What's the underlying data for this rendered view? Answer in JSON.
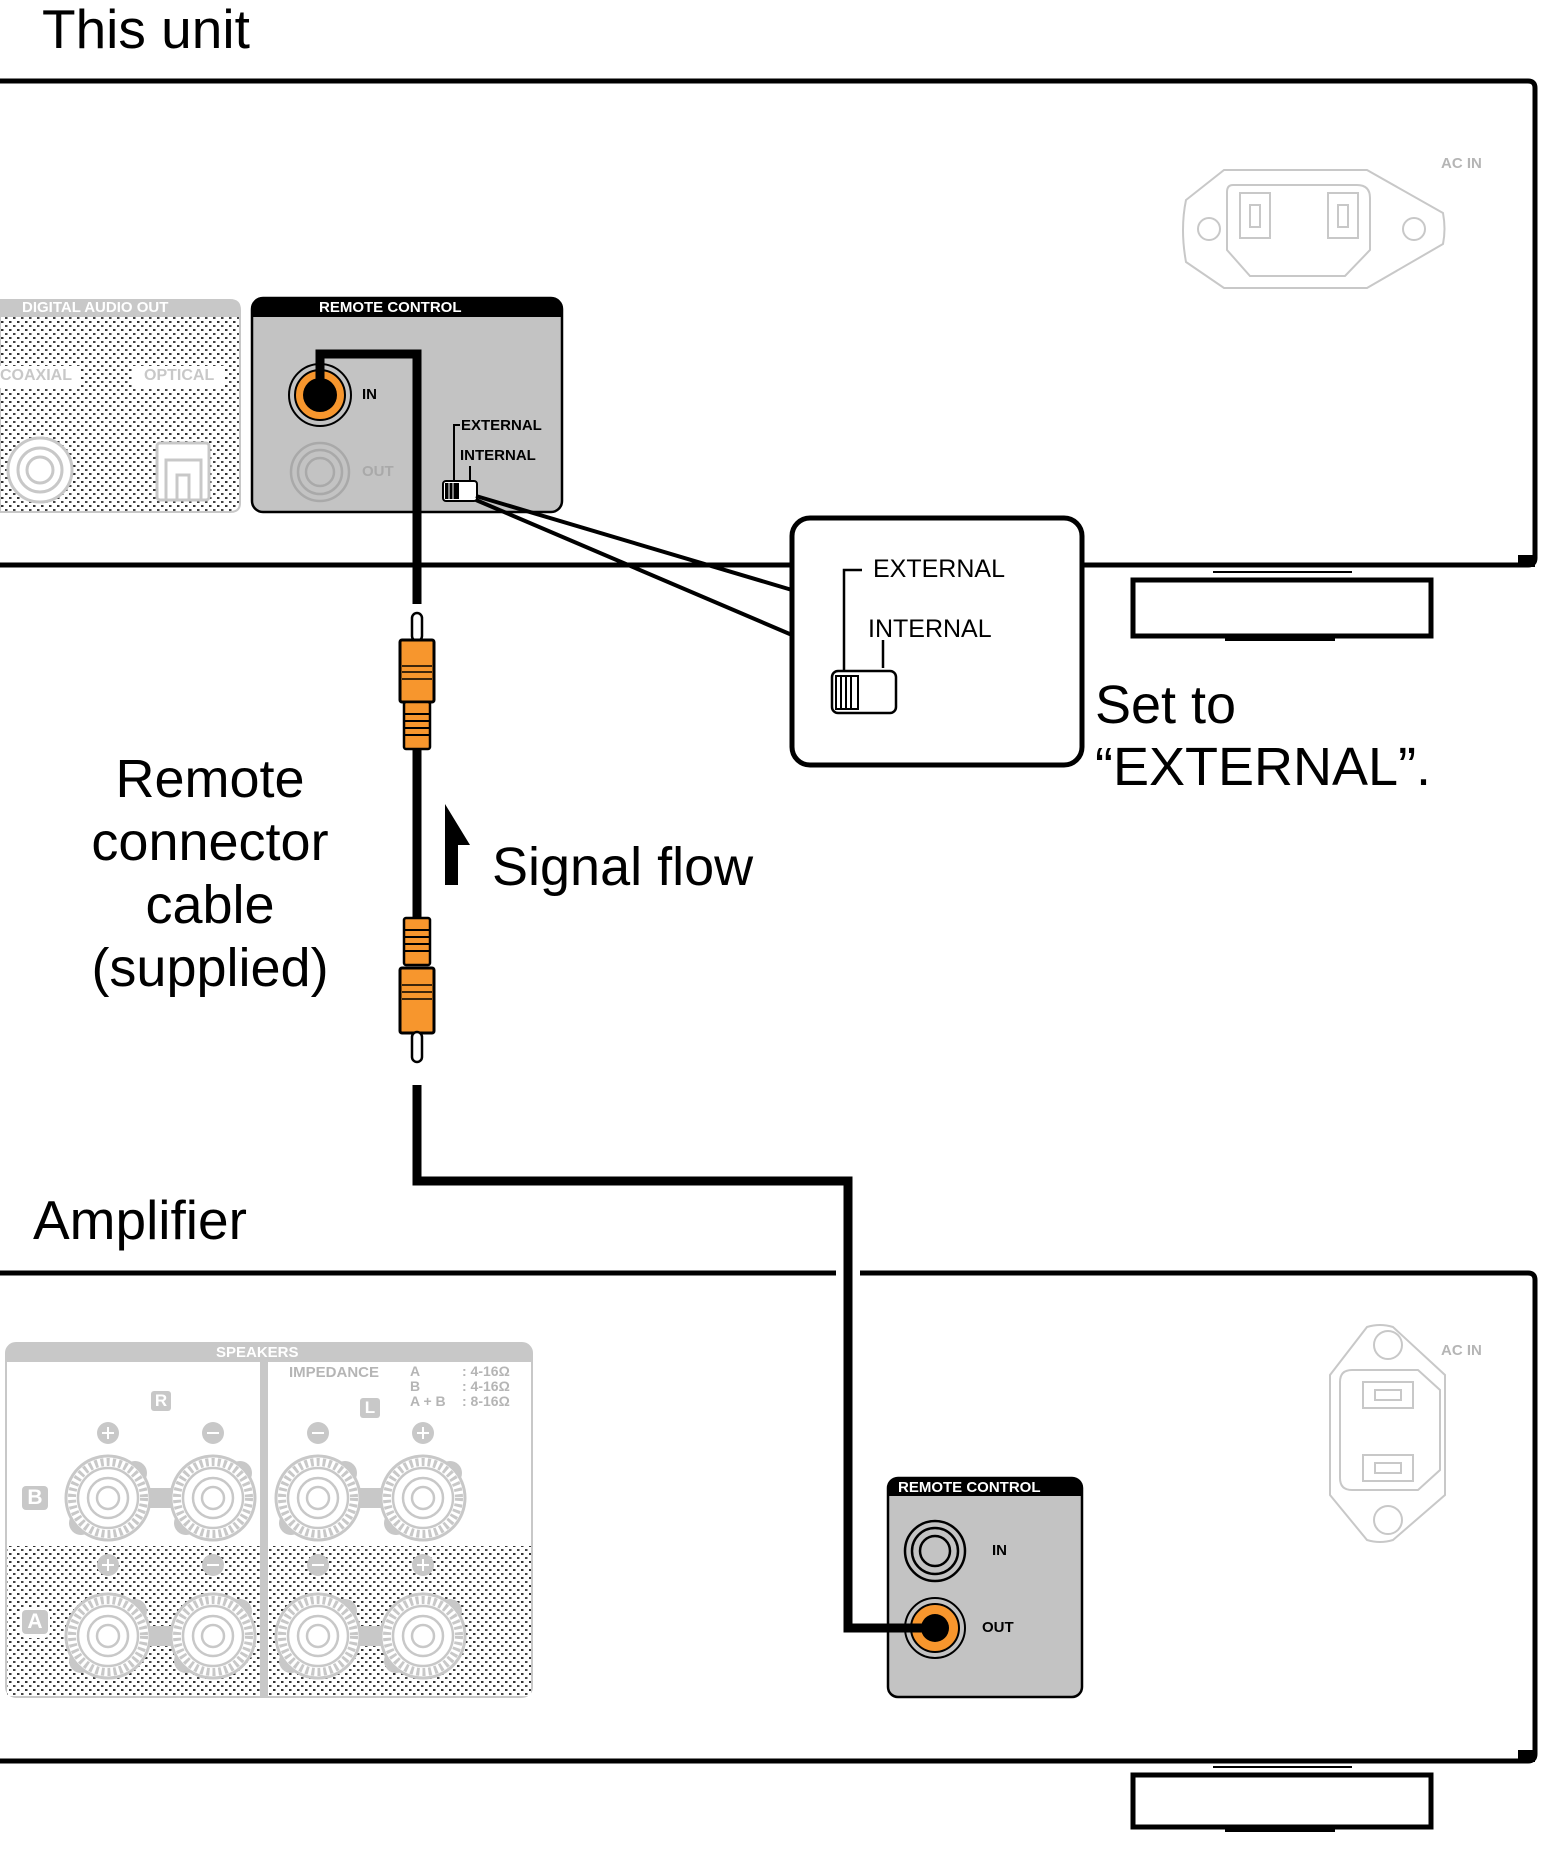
{
  "title_this_unit": "This unit",
  "title_amplifier": "Amplifier",
  "cable_label": [
    "Remote",
    "connector",
    "cable",
    "(supplied)"
  ],
  "signal_flow_label": "Signal flow",
  "instruction": [
    "Set to",
    "“EXTERNAL”."
  ],
  "colors": {
    "plug": "#f7962d",
    "panel": "#c3c3c3",
    "faded": "#c8c8c8",
    "line": "#000000"
  },
  "this_unit": {
    "ac_in_label": "AC IN",
    "digital_audio_out": {
      "title": "DIGITAL AUDIO OUT",
      "coaxial": "COAXIAL",
      "optical": "OPTICAL"
    },
    "remote_control": {
      "title": "REMOTE CONTROL",
      "in": "IN",
      "out": "OUT",
      "switch_external": "EXTERNAL",
      "switch_internal": "INTERNAL",
      "switch_position": "EXTERNAL"
    }
  },
  "callout": {
    "external": "EXTERNAL",
    "internal": "INTERNAL"
  },
  "amplifier": {
    "ac_in_label": "AC IN",
    "speakers": {
      "title": "SPEAKERS",
      "impedance_label": "IMPEDANCE",
      "impedance_rows": [
        {
          "key": "A",
          "value": ": 4-16Ω"
        },
        {
          "key": "B",
          "value": ": 4-16Ω"
        },
        {
          "key": "A + B",
          "value": ": 8-16Ω"
        }
      ],
      "channel_r": "R",
      "channel_l": "L",
      "row_b": "B",
      "row_a": "A"
    },
    "remote_control": {
      "title": "REMOTE CONTROL",
      "in": "IN",
      "out": "OUT"
    }
  }
}
